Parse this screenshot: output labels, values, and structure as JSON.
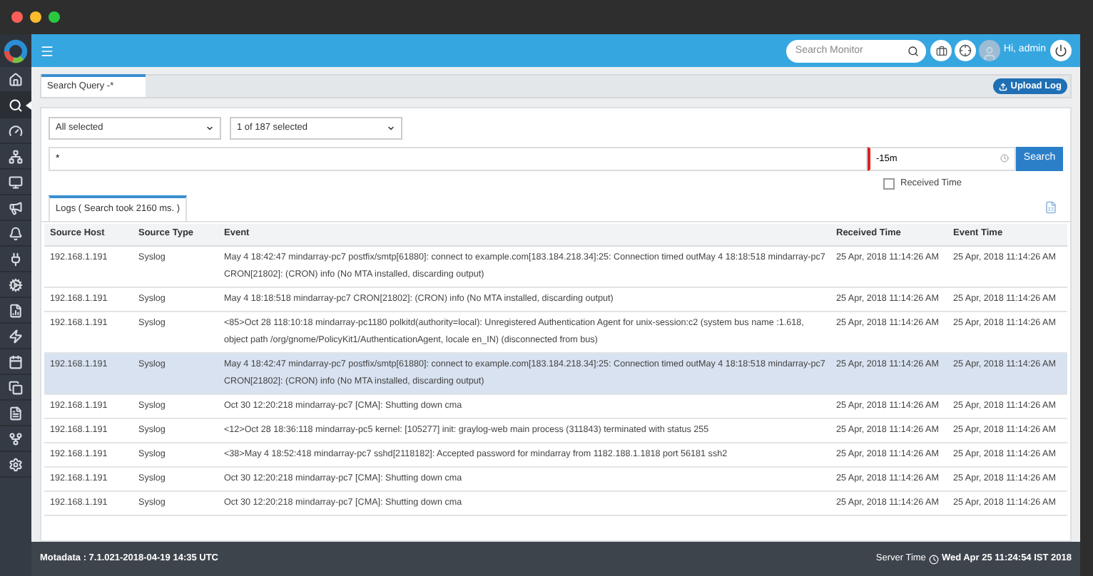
{
  "sidebar": {
    "items": [
      {
        "kind": "home",
        "selected": false
      },
      {
        "kind": "search",
        "selected": true
      },
      {
        "kind": "gauge",
        "selected": false
      },
      {
        "kind": "network",
        "selected": false
      },
      {
        "kind": "monitor",
        "selected": false
      },
      {
        "kind": "megaphone",
        "selected": false
      },
      {
        "kind": "bell",
        "selected": false
      },
      {
        "kind": "plug",
        "selected": false
      },
      {
        "kind": "cogs",
        "selected": false
      },
      {
        "kind": "report",
        "selected": false
      },
      {
        "kind": "bolt",
        "selected": false
      },
      {
        "kind": "calendar",
        "selected": false
      },
      {
        "kind": "copy",
        "selected": false
      },
      {
        "kind": "file",
        "selected": false
      },
      {
        "kind": "fork",
        "selected": false
      },
      {
        "kind": "settings",
        "selected": false
      }
    ]
  },
  "header": {
    "search": {
      "placeholder": "Search Monitor"
    },
    "greeting": "Hi, admin"
  },
  "tabs": [
    {
      "label": "Search Query -*",
      "selected": true
    }
  ],
  "upload_button": "Upload Log",
  "filters": {
    "host_select": "All selected",
    "type_select": "1 of 187 selected",
    "query": "*",
    "time_range": "-15m",
    "search_button": "Search",
    "received_time": {
      "label": "Received Time",
      "checked": false
    }
  },
  "logs_tab": {
    "label": "Logs ( Search took 2160 ms. )",
    "selected": true
  },
  "table": {
    "columns": [
      "Source Host",
      "Source Type",
      "Event",
      "Received Time",
      "Event Time"
    ],
    "rows": [
      {
        "selected": false,
        "cells": [
          "192.168.1.191",
          "Syslog",
          "May 4 18:42:47 mindarray-pc7 postfix/smtp[61880]: connect to example.com[183.184.218.34]:25: Connection timed outMay 4 18:18:518 mindarray-pc7 CRON[21802]: (CRON) info (No MTA installed, discarding output)",
          "25 Apr, 2018 11:14:26 AM",
          "25 Apr, 2018 11:14:26 AM"
        ]
      },
      {
        "selected": false,
        "cells": [
          "192.168.1.191",
          "Syslog",
          "May 4 18:18:518 mindarray-pc7 CRON[21802]: (CRON) info (No MTA installed, discarding output)",
          "25 Apr, 2018 11:14:26 AM",
          "25 Apr, 2018 11:14:26 AM"
        ]
      },
      {
        "selected": false,
        "cells": [
          "192.168.1.191",
          "Syslog",
          "<85>Oct 28 118:10:18 mindarray-pc1180 polkitd(authority=local): Unregistered Authentication Agent for unix-session:c2 (system bus name :1.618, object path /org/gnome/PolicyKit1/AuthenticationAgent, locale en_IN) (disconnected from bus)",
          "25 Apr, 2018 11:14:26 AM",
          "25 Apr, 2018 11:14:26 AM"
        ]
      },
      {
        "selected": true,
        "cells": [
          "192.168.1.191",
          "Syslog",
          "May 4 18:42:47 mindarray-pc7 postfix/smtp[61880]: connect to example.com[183.184.218.34]:25: Connection timed outMay 4 18:18:518 mindarray-pc7 CRON[21802]: (CRON) info (No MTA installed, discarding output)",
          "25 Apr, 2018 11:14:26 AM",
          "25 Apr, 2018 11:14:26 AM"
        ]
      },
      {
        "selected": false,
        "cells": [
          "192.168.1.191",
          "Syslog",
          "Oct 30 12:20:218 mindarray-pc7 [CMA]: Shutting down cma",
          "25 Apr, 2018 11:14:26 AM",
          "25 Apr, 2018 11:14:26 AM"
        ]
      },
      {
        "selected": false,
        "cells": [
          "192.168.1.191",
          "Syslog",
          "<12>Oct 28 18:36:118 mindarray-pc5 kernel: [105277] init: graylog-web main process (311843) terminated with status 255",
          "25 Apr, 2018 11:14:26 AM",
          "25 Apr, 2018 11:14:26 AM"
        ]
      },
      {
        "selected": false,
        "cells": [
          "192.168.1.191",
          "Syslog",
          "<38>May 4 18:52:418 mindarray-pc7 sshd[2118182]: Accepted password for mindarray from 1182.188.1.1818 port 56181 ssh2",
          "25 Apr, 2018 11:14:26 AM",
          "25 Apr, 2018 11:14:26 AM"
        ]
      },
      {
        "selected": false,
        "cells": [
          "192.168.1.191",
          "Syslog",
          "Oct 30 12:20:218 mindarray-pc7 [CMA]: Shutting down cma",
          "25 Apr, 2018 11:14:26 AM",
          "25 Apr, 2018 11:14:26 AM"
        ]
      },
      {
        "selected": false,
        "cells": [
          "192.168.1.191",
          "Syslog",
          "Oct 30 12:20:218 mindarray-pc7 [CMA]: Shutting down cma",
          "25 Apr, 2018 11:14:26 AM",
          "25 Apr, 2018 11:14:26 AM"
        ]
      }
    ]
  },
  "footer": {
    "version": "Motadata : 7.1.021-2018-04-19 14:35 UTC",
    "server_time_label": "Server Time",
    "server_time": "Wed Apr 25 11:24:54 IST 2018"
  }
}
